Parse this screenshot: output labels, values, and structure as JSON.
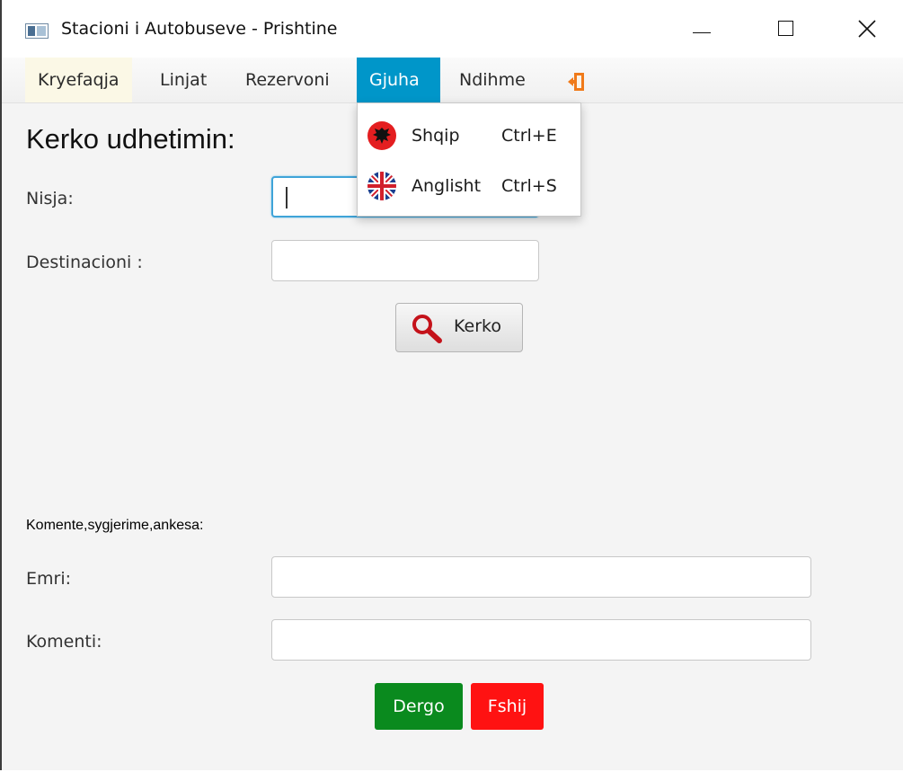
{
  "window": {
    "title": "Stacioni i Autobuseve - Prishtine"
  },
  "menu": {
    "items": [
      {
        "label": "Kryefaqja"
      },
      {
        "label": "Linjat"
      },
      {
        "label": "Rezervoni"
      },
      {
        "label": "Gjuha"
      },
      {
        "label": "Ndihme"
      }
    ],
    "exit_icon": "exit-door-icon",
    "open_menu_color": "#0096c9"
  },
  "dropdown": {
    "items": [
      {
        "label": "Shqip",
        "shortcut": "Ctrl+E",
        "icon": "albania-flag-icon"
      },
      {
        "label": "Anglisht",
        "shortcut": "Ctrl+S",
        "icon": "uk-flag-icon"
      }
    ]
  },
  "search": {
    "heading": "Kerko udhetimin:",
    "departure_label": "Nisja:",
    "departure_value": "",
    "destination_label": "Destinacioni :",
    "destination_value": "",
    "button_label": "Kerko"
  },
  "feedback": {
    "section_label": "Komente,sygjerime,ankesa:",
    "name_label": "Emri:",
    "name_value": "",
    "comment_label": "Komenti:",
    "comment_value": "",
    "send_label": "Dergo",
    "clear_label": "Fshij",
    "send_color": "#0a8a1e",
    "clear_color": "#ff1212"
  }
}
